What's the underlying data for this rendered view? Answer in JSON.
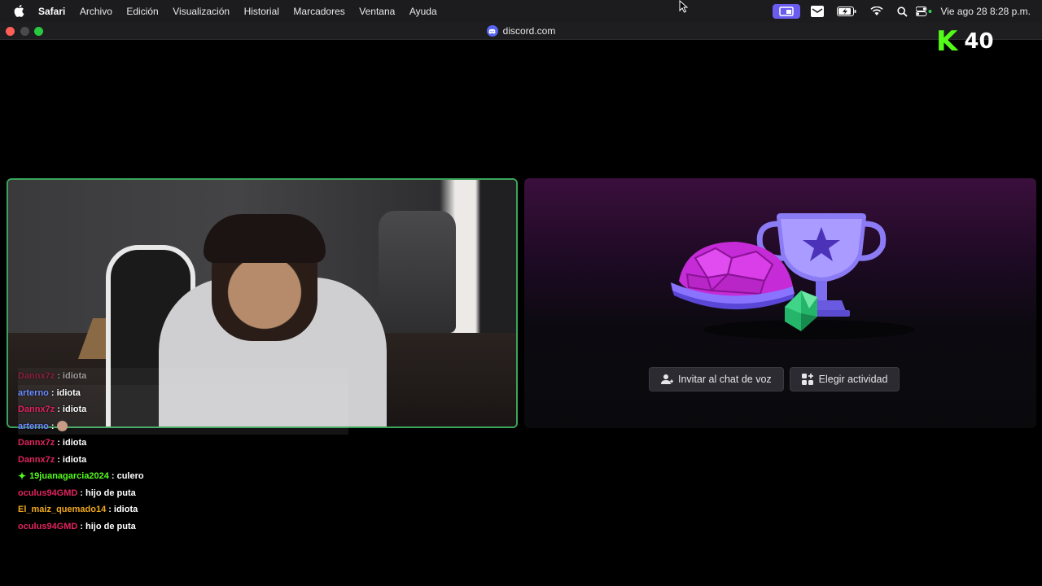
{
  "menubar": {
    "app": "Safari",
    "items": [
      "Archivo",
      "Edición",
      "Visualización",
      "Historial",
      "Marcadores",
      "Ventana",
      "Ayuda"
    ],
    "datetime": "Vie ago 28  8:28 p.m."
  },
  "browser": {
    "url": "discord.com"
  },
  "kick_badge": {
    "letter": "K",
    "count": "40"
  },
  "chat": {
    "lines": [
      {
        "user": "Dannx7z",
        "color": "#e0245e",
        "message": "idiota"
      },
      {
        "user": "arterno",
        "color": "#6d8cff",
        "message": "idiota"
      },
      {
        "user": "Dannx7z",
        "color": "#e0245e",
        "message": "idiota"
      },
      {
        "user": "arterno",
        "color": "#6d8cff",
        "message": ""
      },
      {
        "user": "Dannx7z",
        "color": "#e0245e",
        "message": "idiota"
      },
      {
        "user": "Dannx7z",
        "color": "#e0245e",
        "message": "idiota"
      },
      {
        "user": "19juanagarcia2024",
        "color": "#53fc18",
        "message": "culero"
      },
      {
        "user": "oculus94GMD",
        "color": "#e0245e",
        "message": "hijo de puta"
      },
      {
        "user": "El_maiz_quemado14",
        "color": "#f0a81c",
        "message": "idiota"
      },
      {
        "user": "oculus94GMD",
        "color": "#e0245e",
        "message": "hijo de puta"
      }
    ]
  },
  "activity": {
    "invite_label": "Invitar al chat de voz",
    "choose_label": "Elegir actividad"
  },
  "colors": {
    "speaking_border": "#3ba55c",
    "discord_blurple": "#5865f2",
    "kick_green": "#53fc18"
  }
}
